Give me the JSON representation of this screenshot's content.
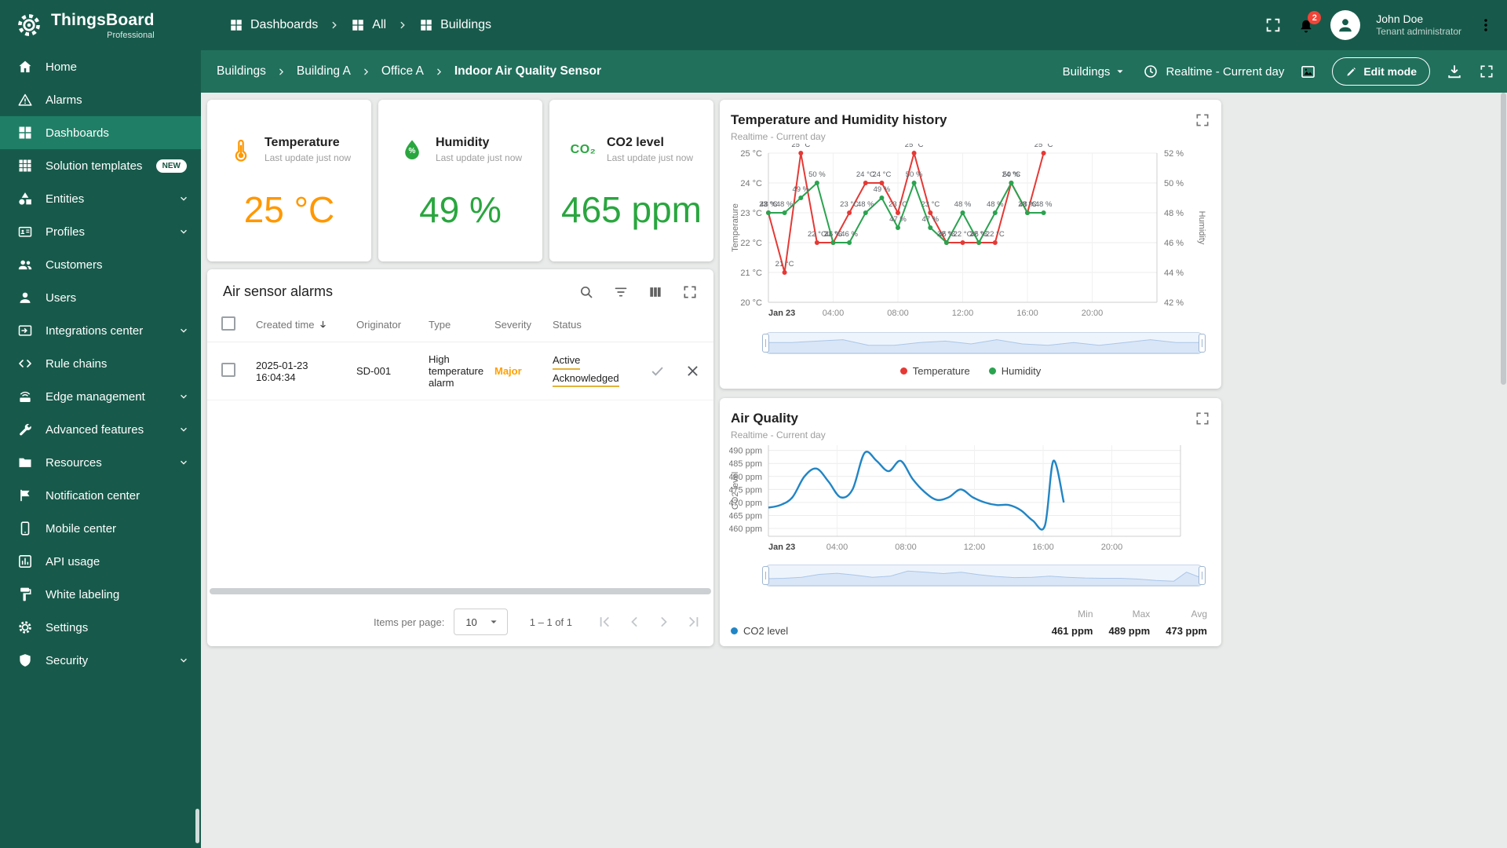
{
  "app": {
    "name": "ThingsBoard",
    "edition": "Professional"
  },
  "topbar": {
    "breadcrumbs": [
      "Dashboards",
      "All",
      "Buildings"
    ],
    "notifications_count": "2",
    "user": {
      "name": "John Doe",
      "role": "Tenant administrator"
    }
  },
  "toolbar": {
    "breadcrumbs": [
      "Buildings",
      "Building A",
      "Office A",
      "Indoor Air Quality Sensor"
    ],
    "state_select": "Buildings",
    "timewindow": "Realtime - Current day",
    "edit_button": "Edit mode"
  },
  "sidebar": {
    "items": [
      {
        "icon": "home",
        "label": "Home"
      },
      {
        "icon": "warning",
        "label": "Alarms"
      },
      {
        "icon": "grid",
        "label": "Dashboards",
        "active": true
      },
      {
        "icon": "apps",
        "label": "Solution templates",
        "badge": "NEW"
      },
      {
        "icon": "category",
        "label": "Entities",
        "chevron": true
      },
      {
        "icon": "badge",
        "label": "Profiles",
        "chevron": true
      },
      {
        "icon": "people",
        "label": "Customers"
      },
      {
        "icon": "person",
        "label": "Users"
      },
      {
        "icon": "integration",
        "label": "Integrations center",
        "chevron": true
      },
      {
        "icon": "code",
        "label": "Rule chains"
      },
      {
        "icon": "router",
        "label": "Edge management",
        "chevron": true
      },
      {
        "icon": "tools",
        "label": "Advanced features",
        "chevron": true
      },
      {
        "icon": "folder",
        "label": "Resources",
        "chevron": true
      },
      {
        "icon": "flag",
        "label": "Notification center"
      },
      {
        "icon": "phone",
        "label": "Mobile center"
      },
      {
        "icon": "chartbox",
        "label": "API usage"
      },
      {
        "icon": "paint",
        "label": "White labeling"
      },
      {
        "icon": "gear",
        "label": "Settings"
      },
      {
        "icon": "shield",
        "label": "Security",
        "chevron": true
      }
    ]
  },
  "cards": {
    "temperature": {
      "title": "Temperature",
      "subtitle": "Last update just now",
      "value": "25 °C"
    },
    "humidity": {
      "title": "Humidity",
      "subtitle": "Last update just now",
      "value": "49 %",
      "icon_label": "%"
    },
    "co2": {
      "title": "CO2 level",
      "subtitle": "Last update just now",
      "value": "465 ppm",
      "icon_label": "CO₂"
    }
  },
  "alarms": {
    "title": "Air sensor alarms",
    "columns": [
      "Created time",
      "Originator",
      "Type",
      "Severity",
      "Status"
    ],
    "rows": [
      {
        "created_time": "2025-01-23 16:04:34",
        "originator": "SD-001",
        "type": "High temperature alarm",
        "severity": "Major",
        "status_lines": [
          "Active",
          "Acknowledged"
        ]
      }
    ],
    "pagination": {
      "items_per_page_label": "Items per page:",
      "page_size": "10",
      "range_label": "1 – 1 of 1"
    }
  },
  "colors": {
    "primary_teal": "#175A4B",
    "toolbar_teal": "#20705C",
    "active_item_teal": "#1F7F66",
    "temperature_accent": "#ff9800",
    "humidity_accent": "#2aa63f",
    "co2_accent": "#2aa63f",
    "severity_major": "#ffa000",
    "temperature_series": "#e53935",
    "humidity_series": "#2aa34f",
    "co2_series": "#2185c5",
    "notification_badge": "#f44336",
    "status_underline": "#e2b33c"
  },
  "chart_data": [
    {
      "type": "line",
      "title": "Temperature and Humidity history",
      "subtitle": "Realtime - Current day",
      "x_axis": {
        "min": 0,
        "max": 24,
        "ticks": [
          {
            "h": 0,
            "label": "Jan 23"
          },
          {
            "h": 4,
            "label": "04:00"
          },
          {
            "h": 8,
            "label": "08:00"
          },
          {
            "h": 12,
            "label": "12:00"
          },
          {
            "h": 16,
            "label": "16:00"
          },
          {
            "h": 20,
            "label": "20:00"
          }
        ]
      },
      "left_axis": {
        "title": "Temperature",
        "unit": "°C",
        "min": 20,
        "max": 25,
        "tick_step": 1
      },
      "right_axis": {
        "title": "Humidity",
        "unit": "%",
        "min": 42,
        "max": 52,
        "tick_step": 2
      },
      "series": [
        {
          "name": "Temperature",
          "unit": "°C",
          "axis": "left",
          "color": "#e53935",
          "x": [
            0,
            1,
            2,
            3,
            4,
            5,
            6,
            7,
            8,
            9,
            10,
            11,
            12,
            13,
            14,
            15,
            16,
            17
          ],
          "values": [
            23,
            21,
            25,
            22,
            22,
            23,
            24,
            24,
            23,
            25,
            23,
            22,
            22,
            22,
            22,
            24,
            23,
            25
          ]
        },
        {
          "name": "Humidity",
          "unit": "%",
          "axis": "right",
          "color": "#2aa34f",
          "x": [
            0,
            1,
            2,
            3,
            4,
            5,
            6,
            7,
            8,
            9,
            10,
            11,
            12,
            13,
            14,
            15,
            16,
            17
          ],
          "values": [
            48,
            48,
            49,
            50,
            46,
            46,
            48,
            49,
            47,
            50,
            47,
            46,
            48,
            46,
            48,
            50,
            48,
            48
          ]
        }
      ],
      "legend": [
        "Temperature",
        "Humidity"
      ],
      "grid": true,
      "legend_position": "bottom"
    },
    {
      "type": "line",
      "title": "Air Quality",
      "subtitle": "Realtime - Current day",
      "x_axis": {
        "min": 0,
        "max": 24,
        "ticks": [
          {
            "h": 0,
            "label": "Jan 23"
          },
          {
            "h": 4,
            "label": "04:00"
          },
          {
            "h": 8,
            "label": "08:00"
          },
          {
            "h": 12,
            "label": "12:00"
          },
          {
            "h": 16,
            "label": "16:00"
          },
          {
            "h": 20,
            "label": "20:00"
          }
        ]
      },
      "y_axis": {
        "title": "CO2 level",
        "unit": "ppm",
        "min": 457,
        "max": 492,
        "ticks": [
          460,
          465,
          470,
          475,
          480,
          485,
          490
        ]
      },
      "series": [
        {
          "name": "CO2 level",
          "color": "#2185c5",
          "x": [
            0,
            0.7,
            1.4,
            2.1,
            2.8,
            3.5,
            4.2,
            4.9,
            5.6,
            6.3,
            7,
            7.7,
            8.4,
            9.1,
            9.8,
            10.5,
            11.2,
            11.9,
            12.6,
            13.3,
            14,
            14.7,
            15.4,
            16.1,
            16.6,
            17.2
          ],
          "values": [
            468,
            469,
            472,
            480,
            483,
            478,
            472,
            475,
            489,
            486,
            482,
            486,
            479,
            474,
            471,
            472,
            475,
            472,
            470,
            469,
            469,
            467,
            463,
            461,
            486,
            470
          ]
        }
      ],
      "stats": {
        "min_label": "Min",
        "min_value": "461 ppm",
        "max_label": "Max",
        "max_value": "489 ppm",
        "avg_label": "Avg",
        "avg_value": "473 ppm"
      },
      "legend": [
        "CO2 level"
      ],
      "grid": true,
      "legend_position": "bottom-left"
    }
  ]
}
